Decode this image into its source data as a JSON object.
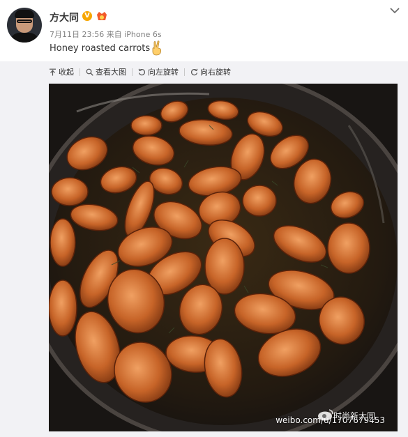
{
  "author": {
    "name": "方大同",
    "verified_icon": "verified-v-icon",
    "vip_icon": "vip-badge-icon"
  },
  "post": {
    "date": "7月11日 23:56",
    "source_prefix": "来自",
    "source": "iPhone 6s",
    "text": "Honey roasted carrots",
    "emoji": "victory-hand-emoji"
  },
  "toolbar": {
    "collapse_label": "收起",
    "view_large_label": "查看大图",
    "rotate_left_label": "向左旋转",
    "rotate_right_label": "向右旋转"
  },
  "image": {
    "watermark_brand": "时尚新大同",
    "watermark_url": "weibo.com/u/1707679453"
  }
}
